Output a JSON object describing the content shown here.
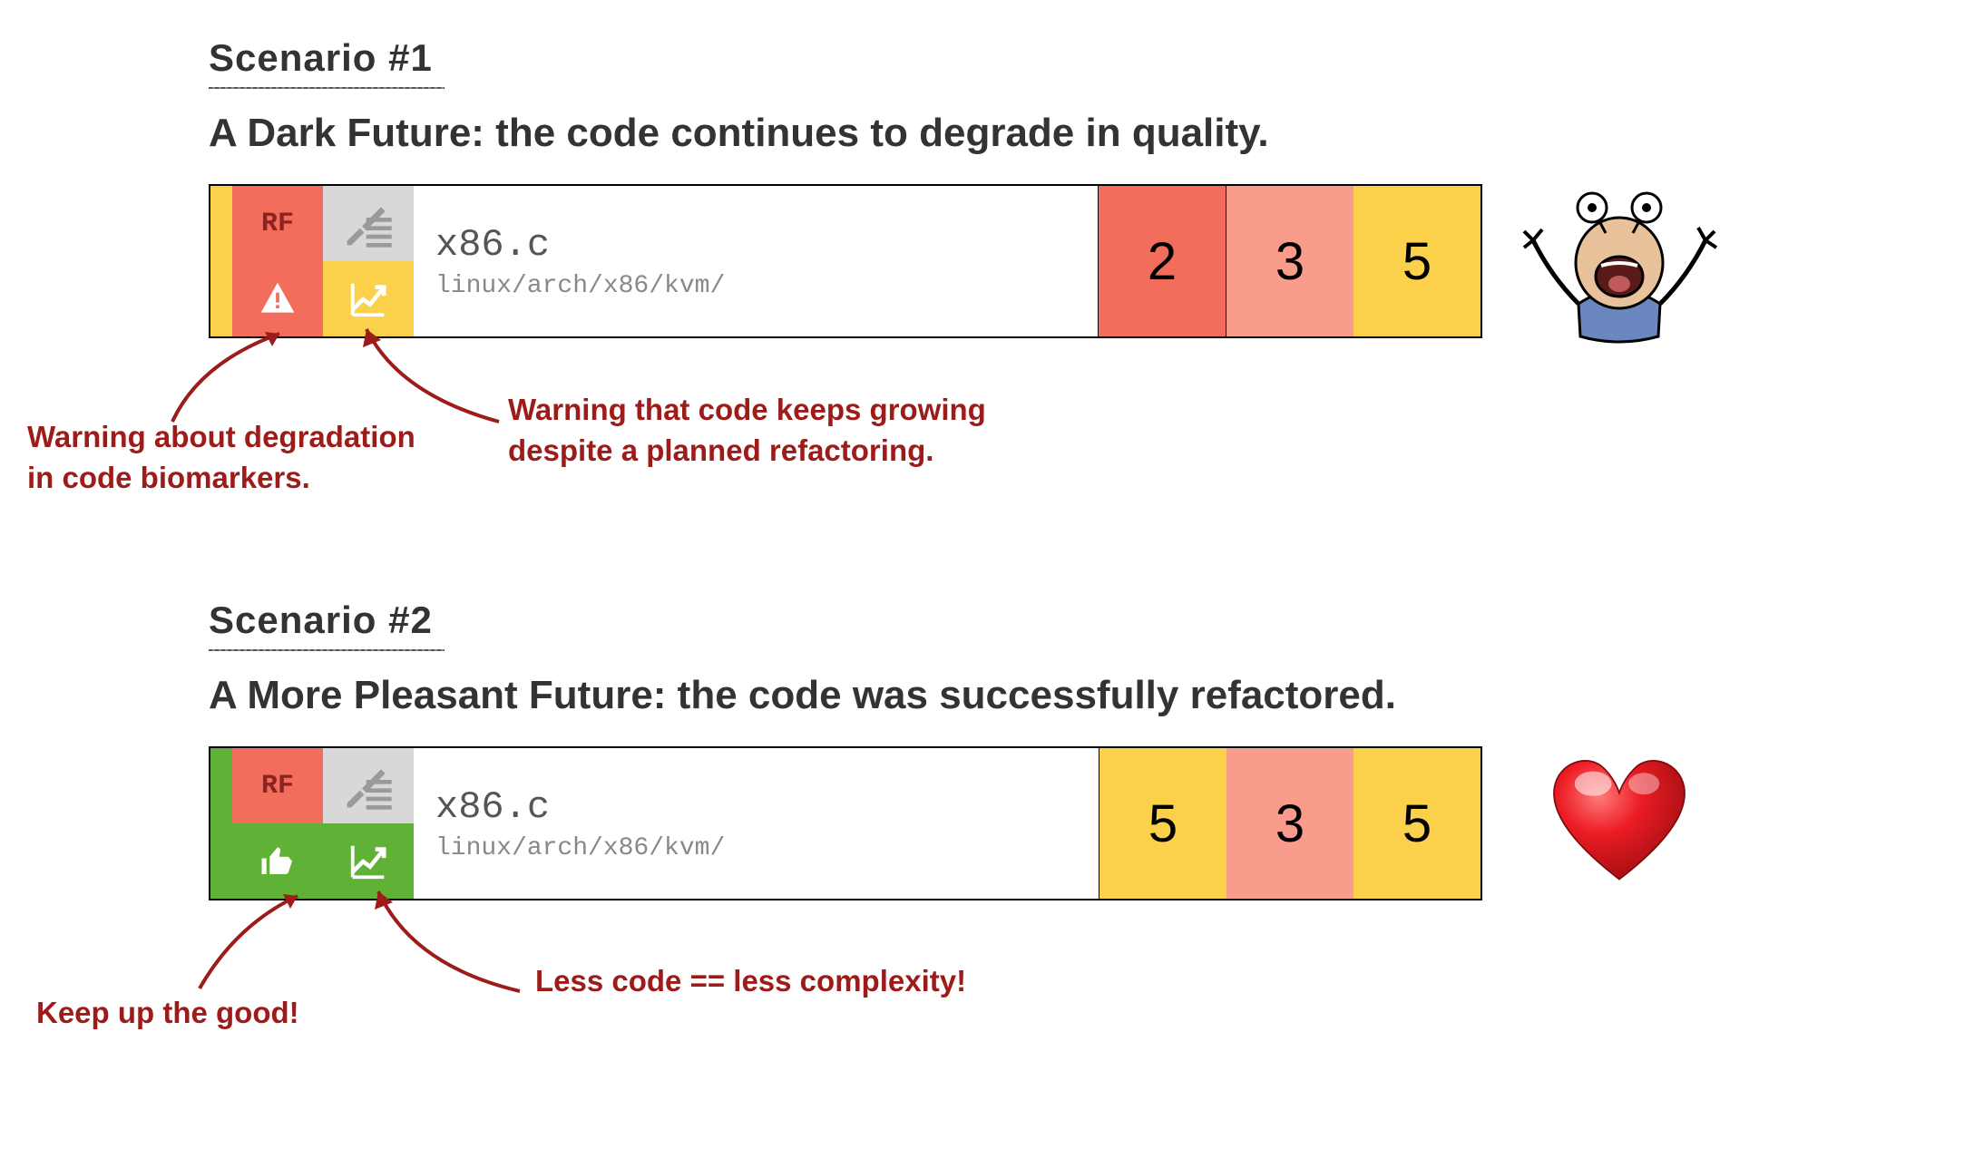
{
  "scenario1": {
    "label": "Scenario #1",
    "subtitle": "A Dark Future: the code continues to degrade in quality.",
    "card": {
      "rf_badge": "RF",
      "filename": "x86.c",
      "filepath": "linux/arch/x86/kvm/",
      "stripe_color": "#FBD14B",
      "status_col_color": "#F26D5B",
      "trend_col_color": "#FBD14B",
      "metrics": [
        {
          "value": "2",
          "class": "m-red"
        },
        {
          "value": "3",
          "class": "m-pink"
        },
        {
          "value": "5",
          "class": "m-yellow"
        }
      ]
    },
    "annotations": [
      {
        "key": "biomarkers",
        "text": "Warning about degradation\nin code biomarkers."
      },
      {
        "key": "growth",
        "text": "Warning that code keeps growing\ndespite a planned refactoring."
      }
    ]
  },
  "scenario2": {
    "label": "Scenario #2",
    "subtitle": "A More Pleasant Future: the code was successfully refactored.",
    "card": {
      "rf_badge": "RF",
      "filename": "x86.c",
      "filepath": "linux/arch/x86/kvm/",
      "stripe_color": "#5FB235",
      "status_col_color": "#5FB235",
      "trend_col_color": "#5FB235",
      "metrics": [
        {
          "value": "5",
          "class": "m-yellow"
        },
        {
          "value": "3",
          "class": "m-pink"
        },
        {
          "value": "5",
          "class": "m-yellow"
        }
      ]
    },
    "annotations": [
      {
        "key": "keepup",
        "text": "Keep up the good!"
      },
      {
        "key": "less",
        "text": "Less code == less complexity!"
      }
    ]
  }
}
